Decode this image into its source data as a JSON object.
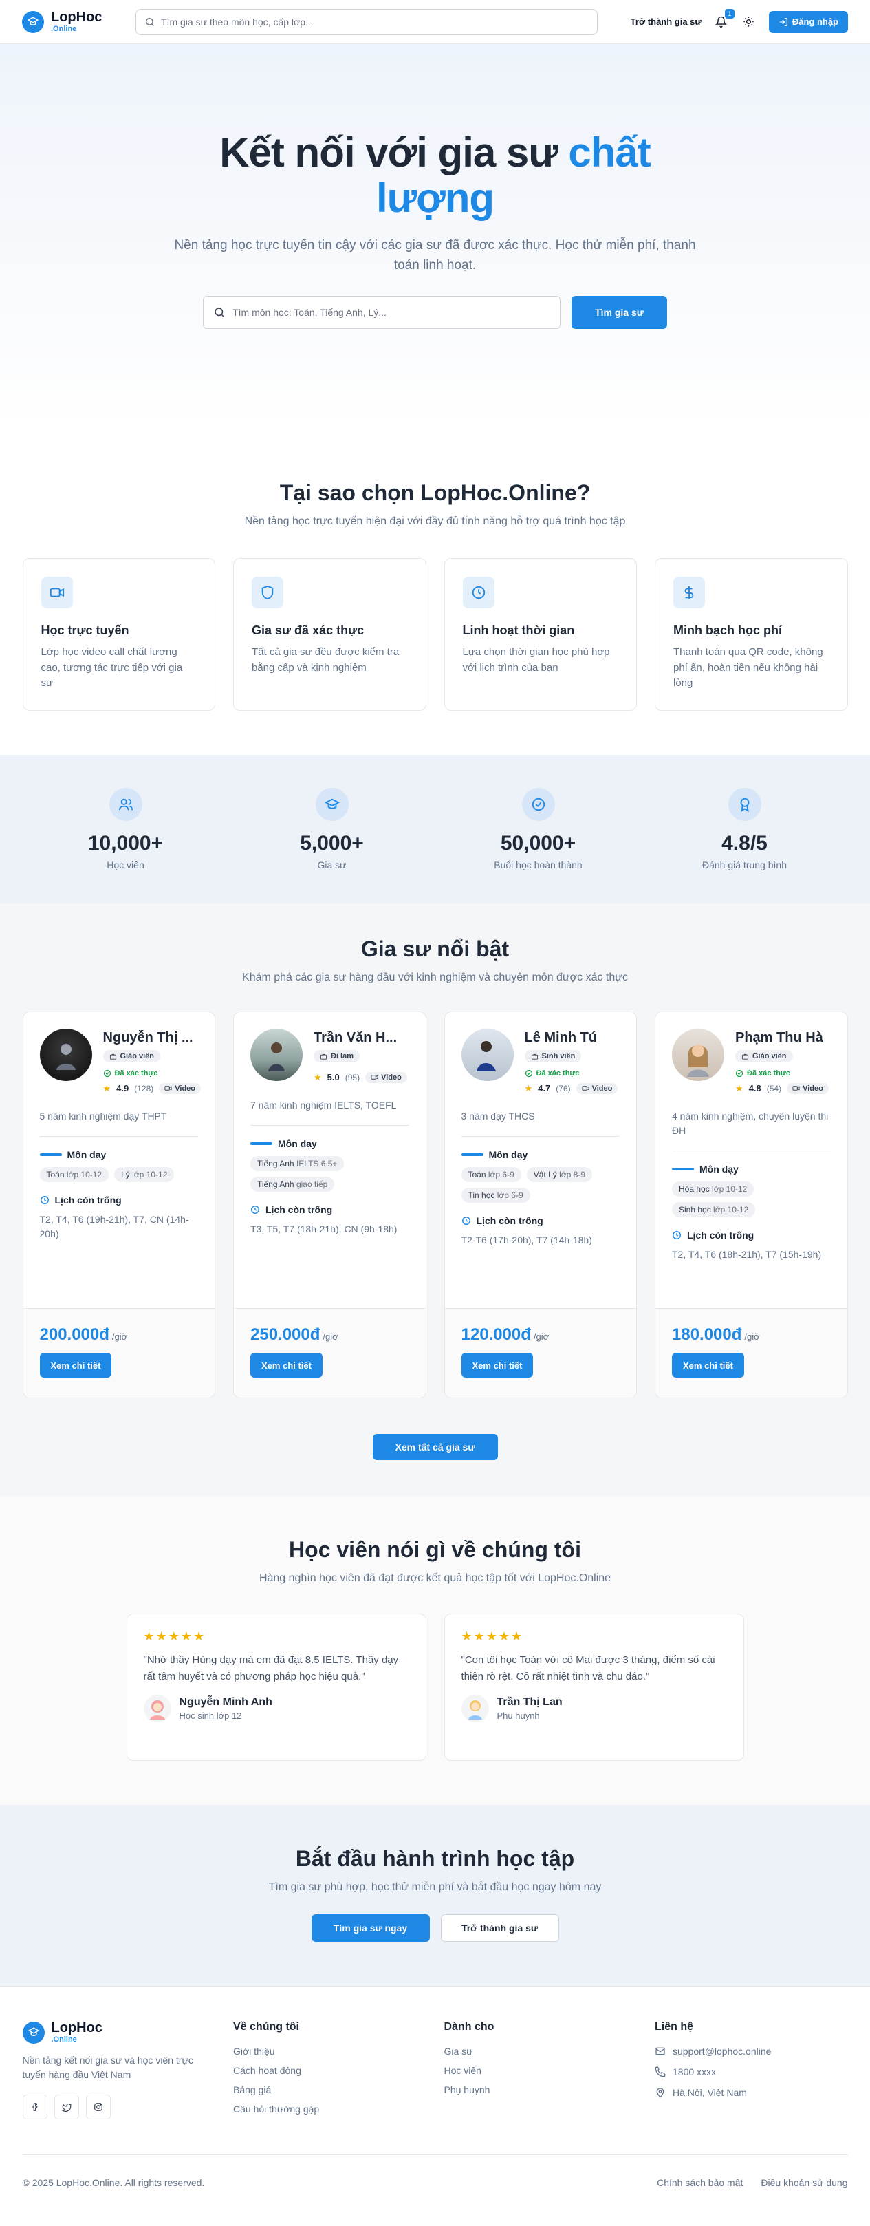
{
  "brand": {
    "name": "LopHoc",
    "suffix": ".Online"
  },
  "header": {
    "search_placeholder": "Tìm gia sư theo môn học, cấp lớp...",
    "become_tutor": "Trở thành gia sư",
    "notification_count": "1",
    "login": "Đăng nhập"
  },
  "hero": {
    "title_main": "Kết nối với gia sư ",
    "title_accent": "chất lượng",
    "subtitle": "Nền tảng học trực tuyến tin cậy với các gia sư đã được xác thực. Học thử miễn phí, thanh toán linh hoạt.",
    "search_placeholder": "Tìm môn học: Toán, Tiếng Anh, Lý...",
    "search_button": "Tìm gia sư"
  },
  "why": {
    "title": "Tại sao chọn LopHoc.Online?",
    "subtitle": "Nền tảng học trực tuyến hiện đại với đầy đủ tính năng hỗ trợ quá trình học tập",
    "features": [
      {
        "icon": "video-icon",
        "title": "Học trực tuyến",
        "desc": "Lớp học video call chất lượng cao, tương tác trực tiếp với gia sư"
      },
      {
        "icon": "shield-icon",
        "title": "Gia sư đã xác thực",
        "desc": "Tất cả gia sư đều được kiểm tra bằng cấp và kinh nghiệm"
      },
      {
        "icon": "clock-icon",
        "title": "Linh hoạt thời gian",
        "desc": "Lựa chọn thời gian học phù hợp với lịch trình của bạn"
      },
      {
        "icon": "dollar-icon",
        "title": "Minh bạch học phí",
        "desc": "Thanh toán qua QR code, không phí ẩn, hoàn tiền nếu không hài lòng"
      }
    ]
  },
  "stats": [
    {
      "icon": "users-icon",
      "value": "10,000+",
      "label": "Học viên"
    },
    {
      "icon": "graduation-cap-icon",
      "value": "5,000+",
      "label": "Gia sư"
    },
    {
      "icon": "check-circle-icon",
      "value": "50,000+",
      "label": "Buổi học hoàn thành"
    },
    {
      "icon": "award-icon",
      "value": "4.8/5",
      "label": "Đánh giá trung bình"
    }
  ],
  "tutors": {
    "title": "Gia sư nổi bật",
    "subtitle": "Khám phá các gia sư hàng đầu với kinh nghiệm và chuyên môn được xác thực",
    "subjects_label": "Môn dạy",
    "schedule_label": "Lịch còn trống",
    "verified_label": "Đã xác thực",
    "video_label": "Video",
    "price_unit": "/giờ",
    "detail_button": "Xem chi tiết",
    "all_button": "Xem tất cả gia sư",
    "items": [
      {
        "name": "Nguyễn Thị ...",
        "role": "Giáo viên",
        "rating": "4.9",
        "reviews": "(128)",
        "experience": "5 năm kinh nghiệm dạy THPT",
        "subjects": [
          {
            "name": "Toán",
            "level": "lớp 10-12"
          },
          {
            "name": "Lý",
            "level": "lớp 10-12"
          }
        ],
        "schedule": "T2, T4, T6 (19h-21h), T7, CN (14h-20h)",
        "price": "200.000đ"
      },
      {
        "name": "Trần Văn H...",
        "role": "Đi làm",
        "rating": "5.0",
        "reviews": "(95)",
        "experience": "7 năm kinh nghiệm IELTS, TOEFL",
        "subjects": [
          {
            "name": "Tiếng Anh",
            "level": "IELTS 6.5+"
          },
          {
            "name": "Tiếng Anh",
            "level": "giao tiếp"
          }
        ],
        "schedule": "T3, T5, T7 (18h-21h), CN (9h-18h)",
        "price": "250.000đ"
      },
      {
        "name": "Lê Minh Tú",
        "role": "Sinh viên",
        "rating": "4.7",
        "reviews": "(76)",
        "experience": "3 năm dạy THCS",
        "subjects": [
          {
            "name": "Toán",
            "level": "lớp 6-9"
          },
          {
            "name": "Vật Lý",
            "level": "lớp 8-9"
          },
          {
            "name": "Tin học",
            "level": "lớp 6-9"
          }
        ],
        "schedule": "T2-T6 (17h-20h), T7 (14h-18h)",
        "price": "120.000đ"
      },
      {
        "name": "Phạm Thu Hà",
        "role": "Giáo viên",
        "rating": "4.8",
        "reviews": "(54)",
        "experience": "4 năm kinh nghiệm, chuyên luyện thi ĐH",
        "subjects": [
          {
            "name": "Hóa học",
            "level": "lớp 10-12"
          },
          {
            "name": "Sinh học",
            "level": "lớp 10-12"
          }
        ],
        "schedule": "T2, T4, T6 (18h-21h), T7 (15h-19h)",
        "price": "180.000đ"
      }
    ]
  },
  "testimonials": {
    "title": "Học viên nói gì về chúng tôi",
    "subtitle": "Hàng nghìn học viên đã đạt được kết quả học tập tốt với LopHoc.Online",
    "stars": "★★★★★",
    "items": [
      {
        "quote": "\"Nhờ thầy Hùng dạy mà em đã đạt 8.5 IELTS. Thầy dạy rất tâm huyết và có phương pháp học hiệu quả.\"",
        "name": "Nguyễn Minh Anh",
        "role": "Học sinh lớp 12"
      },
      {
        "quote": "\"Con tôi học Toán với cô Mai được 3 tháng, điểm số cải thiện rõ rệt. Cô rất nhiệt tình và chu đáo.\"",
        "name": "Trần Thị Lan",
        "role": "Phụ huynh"
      }
    ]
  },
  "cta": {
    "title": "Bắt đầu hành trình học tập",
    "subtitle": "Tìm gia sư phù hợp, học thử miễn phí và bắt đầu học ngay hôm nay",
    "primary": "Tìm gia sư ngay",
    "secondary": "Trở thành gia sư"
  },
  "footer": {
    "desc": "Nền tảng kết nối gia sư và học viên trực tuyến hàng đầu Việt Nam",
    "about_title": "Về chúng tôi",
    "about_links": [
      "Giới thiệu",
      "Cách hoạt động",
      "Bảng giá",
      "Câu hỏi thường gặp"
    ],
    "for_title": "Dành cho",
    "for_links": [
      "Gia sư",
      "Học viên",
      "Phụ huynh"
    ],
    "contact_title": "Liên hệ",
    "email": "support@lophoc.online",
    "phone": "1800 xxxx",
    "address": "Hà Nội, Việt Nam",
    "copyright": "© 2025 LopHoc.Online. All rights reserved.",
    "privacy": "Chính sách bảo mật",
    "terms": "Điều khoản sử dụng"
  }
}
